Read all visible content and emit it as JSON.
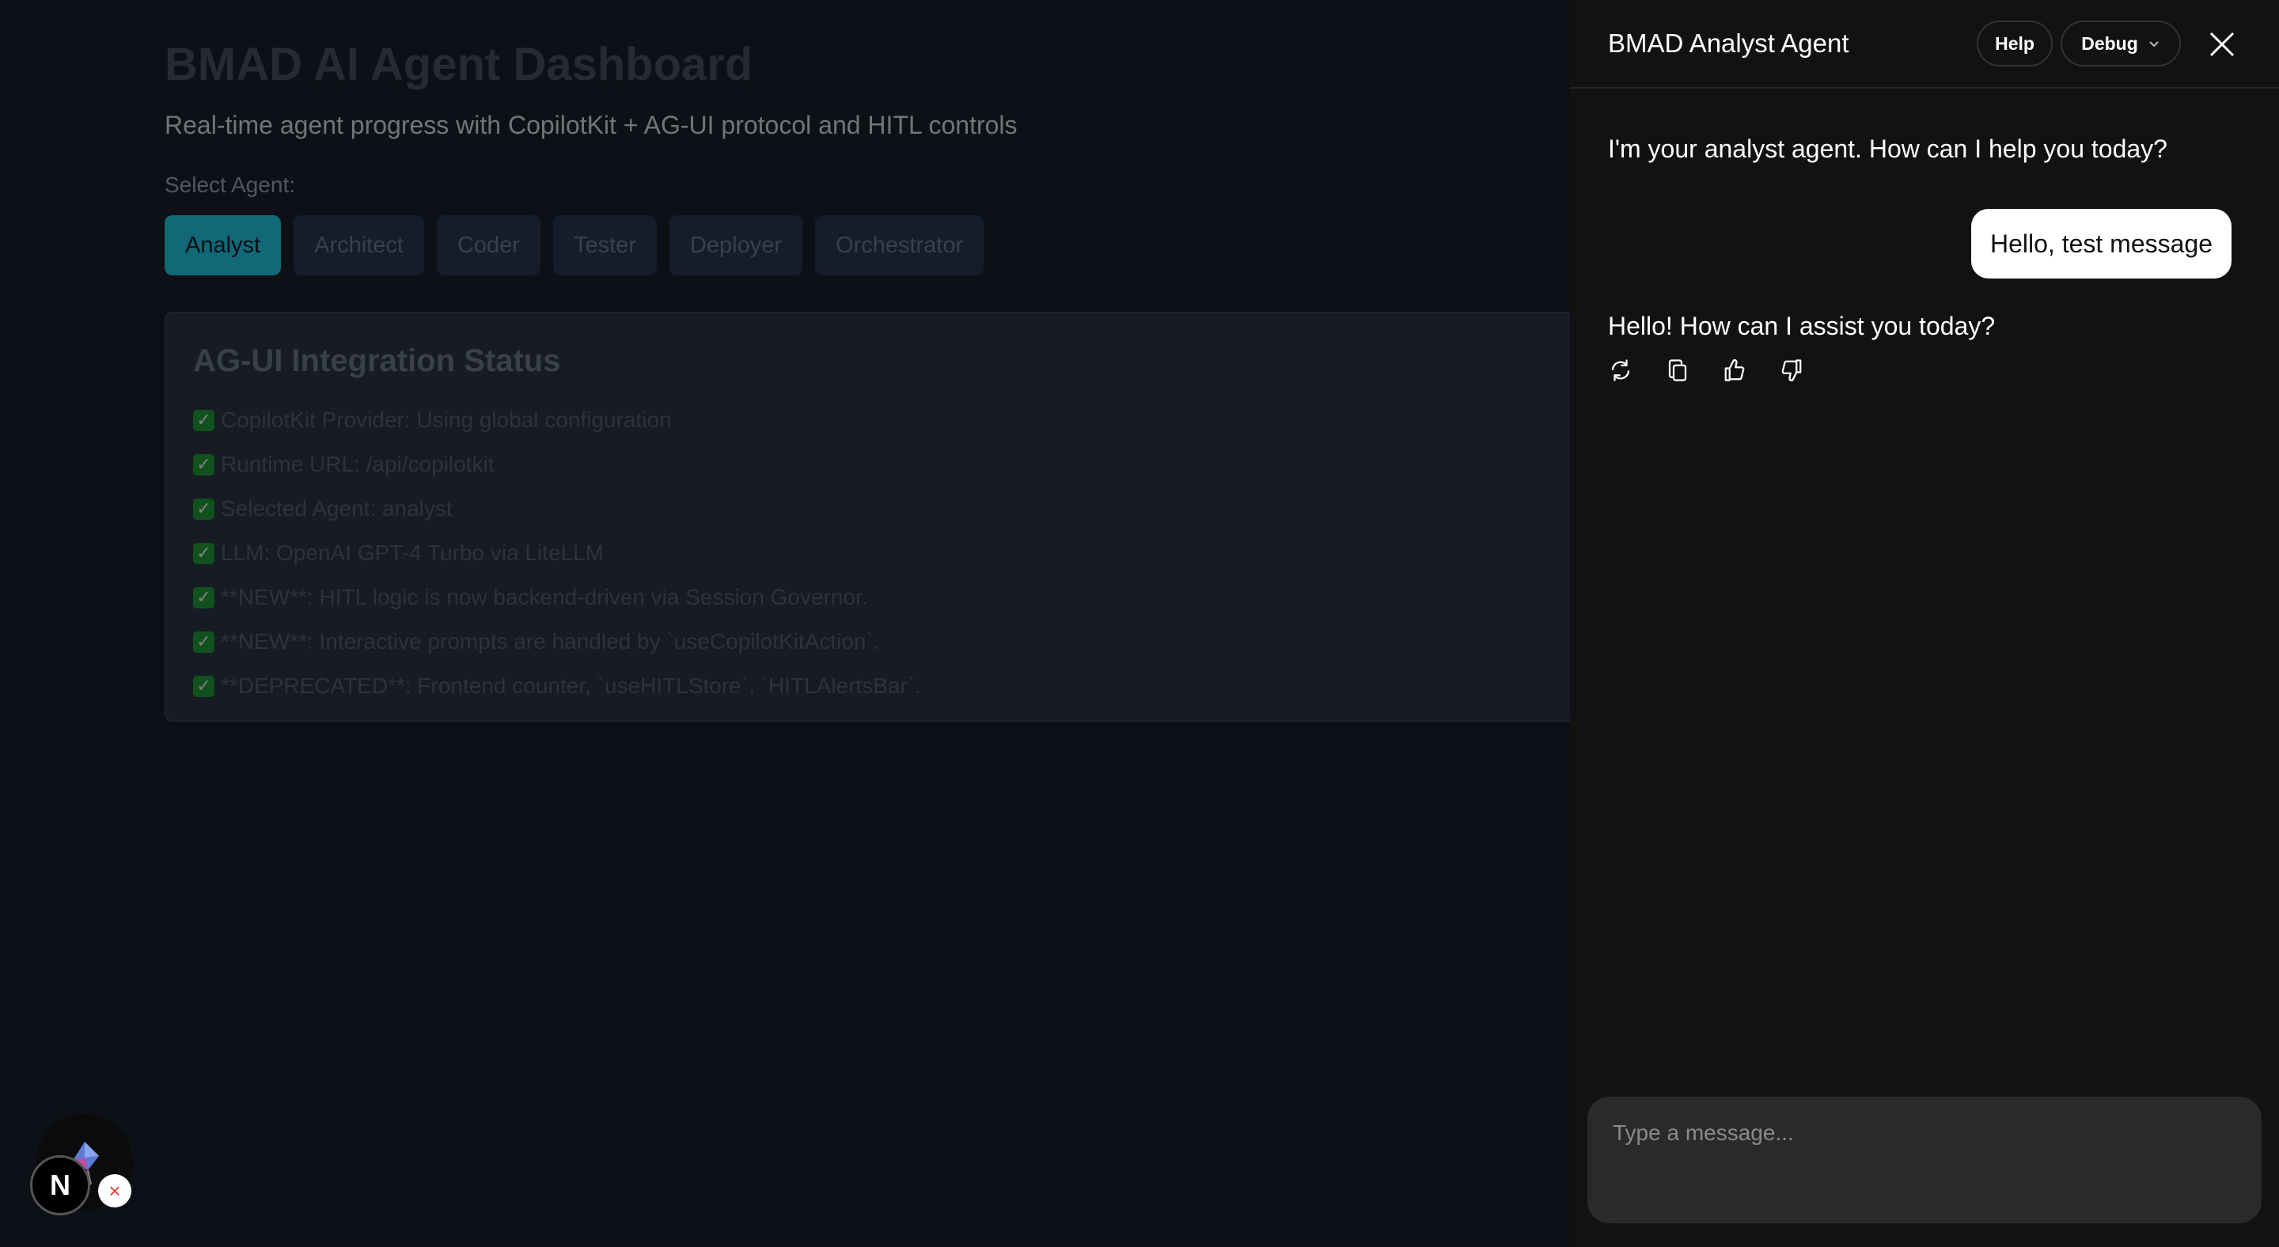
{
  "dashboard": {
    "title": "BMAD AI Agent Dashboard",
    "subtitle": "Real-time agent progress with CopilotKit + AG-UI protocol and HITL controls",
    "select_label": "Select Agent:",
    "agents": [
      {
        "label": "Analyst",
        "active": true
      },
      {
        "label": "Architect",
        "active": false
      },
      {
        "label": "Coder",
        "active": false
      },
      {
        "label": "Tester",
        "active": false
      },
      {
        "label": "Deployer",
        "active": false
      },
      {
        "label": "Orchestrator",
        "active": false
      }
    ],
    "status_card": {
      "title": "AG-UI Integration Status",
      "check_glyph": "✓",
      "lines": [
        "CopilotKit Provider: Using global configuration",
        "Runtime URL: /api/copilotkit",
        "Selected Agent: analyst",
        "LLM: OpenAI GPT-4 Turbo via LiteLLM",
        "**NEW**: HITL logic is now backend-driven via Session Governor.",
        "**NEW**: Interactive prompts are handled by `useCopilotKitAction`.",
        "**DEPRECATED**: Frontend counter, `useHITLStore`, `HITLAlertsBar`."
      ]
    }
  },
  "dev_overlay": {
    "next_badge": "N",
    "close_badge": "×",
    "icons": [
      "kite-logo-icon"
    ]
  },
  "chat": {
    "title": "BMAD Analyst Agent",
    "help_label": "Help",
    "debug_label": "Debug",
    "messages": [
      {
        "role": "assistant",
        "text": "I'm your analyst agent. How can I help you today?"
      },
      {
        "role": "user",
        "text": "Hello, test message"
      },
      {
        "role": "assistant",
        "text": "Hello! How can I assist you today?"
      }
    ],
    "message_actions": [
      "regenerate-icon",
      "copy-icon",
      "thumbs-up-icon",
      "thumbs-down-icon"
    ],
    "composer_placeholder": "Type a message..."
  },
  "colors": {
    "accent_active_tab": "#22d3ee",
    "panel_bg": "#121212",
    "page_bg": "#1a202c",
    "check_green": "#22a33a"
  }
}
